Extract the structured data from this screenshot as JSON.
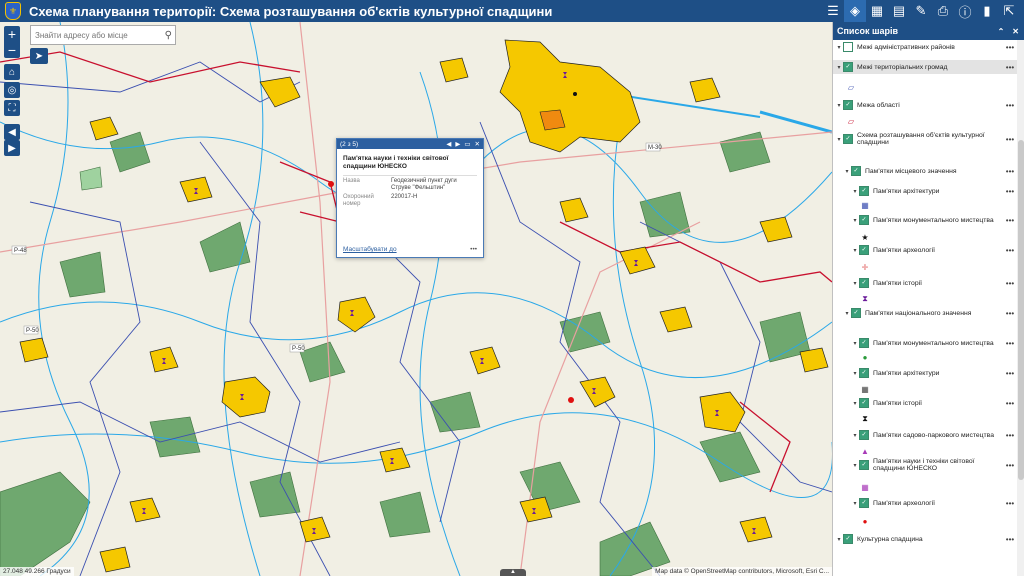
{
  "app": {
    "title": "Схема планування території: Схема розташування об'єктів культурної спадщини"
  },
  "header_icons": [
    "layers-icon",
    "basemap-icon",
    "table-icon",
    "draw-icon",
    "print-icon",
    "info-icon",
    "bookmark-icon",
    "share-icon"
  ],
  "search": {
    "placeholder": "Знайти адресу або місце"
  },
  "map": {
    "coords": "27.048 49.266 Градуси",
    "attribution": "Map data © OpenStreetMap contributors, Microsoft, Esri C...",
    "road_labels": [
      "M-30",
      "P-50",
      "P-48",
      "P-50"
    ]
  },
  "popup": {
    "counter": "(2 з 5)",
    "title": "Пам'ятка науки і техніки світової спадщини ЮНЕСКО",
    "rows": [
      {
        "key": "Назва",
        "value": "Геодезичний пункт дуги Струве \"Фельштин\""
      },
      {
        "key": "Охоронний номер",
        "value": "220017-Н"
      }
    ],
    "zoom_link": "Масштабувати до",
    "more": "•••"
  },
  "layer_panel": {
    "title": "Список шарів",
    "items": [
      {
        "label": "Межі адміністративних районів",
        "checked": false,
        "level": 1
      },
      {
        "label": "Межі територіальних громад",
        "checked": true,
        "level": 1
      },
      {
        "label": "Межа області",
        "checked": true,
        "level": 1
      },
      {
        "label": "Схема розташування об'єктів культурної спадщини",
        "checked": true,
        "level": 1
      },
      {
        "label": "Пам'ятки місцевого значення",
        "checked": true,
        "level": 2
      },
      {
        "label": "Пам'ятки архітектури",
        "checked": true,
        "level": 3
      },
      {
        "label": "Пам'ятки монументального мистецтва",
        "checked": true,
        "level": 3
      },
      {
        "label": "Пам'ятки археології",
        "checked": true,
        "level": 3
      },
      {
        "label": "Пам'ятки історії",
        "checked": true,
        "level": 3
      },
      {
        "label": "Пам'ятки національного значення",
        "checked": true,
        "level": 2
      },
      {
        "label": "Пам'ятки монументального мистецтва",
        "checked": true,
        "level": 3
      },
      {
        "label": "Пам'ятки архітектури",
        "checked": true,
        "level": 3
      },
      {
        "label": "Пам'ятки історії",
        "checked": true,
        "level": 3
      },
      {
        "label": "Пам'ятки садово-паркового мистецтва",
        "checked": true,
        "level": 3
      },
      {
        "label": "Пам'ятки науки і техніки світової спадщини ЮНЕСКО",
        "checked": true,
        "level": 3
      },
      {
        "label": "Пам'ятки археології",
        "checked": true,
        "level": 3
      },
      {
        "label": "Культурна спадщина",
        "checked": true,
        "level": 1
      }
    ],
    "more": "•••"
  },
  "colors": {
    "header": "#1e4f86",
    "settlement": "#f5c800",
    "forest": "#6fa86f",
    "water": "#2aa8e8",
    "boundary_community": "#3b4fb0",
    "boundary_oblast": "#c8102e"
  }
}
